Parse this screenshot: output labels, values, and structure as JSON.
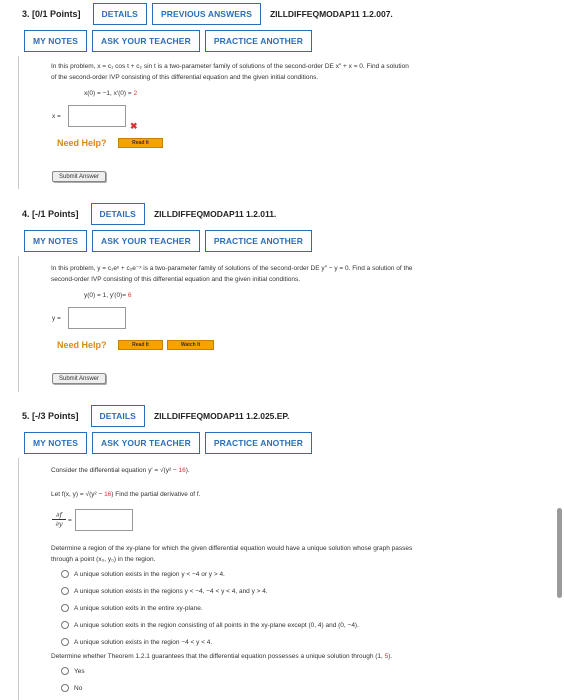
{
  "q3": {
    "number": "3. [0/1 Points]",
    "code": "ZILLDIFFEQMODAP11 1.2.007.",
    "details": "DETAILS",
    "previous": "PREVIOUS ANSWERS",
    "my_notes": "MY NOTES",
    "ask": "ASK YOUR TEACHER",
    "practice": "PRACTICE ANOTHER",
    "prompt_a": "In this problem, x = c₁ cos t + c₂ sin t is a two-parameter family of solutions of the second-order DE x″ + x = 0. Find a solution",
    "prompt_b": "of the second-order IVP consisting of this differential equation and the given initial conditions.",
    "cond_a": "x(0) = −1,  x′(0) = ",
    "cond_b": "2",
    "answer_label": "x =",
    "wrong_mark": "✖",
    "need_help": "Need Help?",
    "read_it": "Read It",
    "submit": "Submit Answer"
  },
  "q4": {
    "number": "4. [-/1 Points]",
    "code": "ZILLDIFFEQMODAP11 1.2.011.",
    "details": "DETAILS",
    "my_notes": "MY NOTES",
    "ask": "ASK YOUR TEACHER",
    "practice": "PRACTICE ANOTHER",
    "prompt_a": "In this problem, y = c₁eˣ + c₂e⁻ˣ is a two-parameter family of solutions of the second-order DE y″ − y = 0. Find a solution of the",
    "prompt_b": "second-order IVP consisting of this differential equation and the given initial conditions.",
    "cond_a": "y(0) = 1,  y′(0)= ",
    "cond_b": "6",
    "answer_label": "y =",
    "need_help": "Need Help?",
    "read_it": "Read It",
    "watch_it": "Watch It",
    "submit": "Submit Answer"
  },
  "q5": {
    "number": "5. [-/3 Points]",
    "code": "ZILLDIFFEQMODAP11 1.2.025.EP.",
    "details": "DETAILS",
    "my_notes": "MY NOTES",
    "ask": "ASK YOUR TEACHER",
    "practice": "PRACTICE ANOTHER",
    "consider_a": "Consider the differential equation y′ = √(y² − ",
    "consider_b": "16",
    "consider_c": ").",
    "let_a": "Let f(x, y) = √(y² − ",
    "let_b": "16",
    "let_c": ")  Find the partial derivative of f.",
    "partial_num": "∂f",
    "partial_den": "∂y",
    "eq": "=",
    "region_a": "Determine a region of the xy-plane for which the given differential equation would have a unique solution whose graph passes",
    "region_b": "through a point (x₀, y₀) in the region.",
    "options": [
      "A unique solution exists in the region y < −4 or y > 4.",
      "A unique solution exists in the regions y < −4, −4 < y < 4, and y > 4.",
      "A unique solution exits in the entire xy-plane.",
      "A unique solution exits in the region consisting of all points in the xy-plane except (0, 4) and (0, −4).",
      "A unique solution exists in the region −4 < y < 4."
    ],
    "theorem_a": "Determine whether Theorem 1.2.1 guarantees that the differential equation possesses a unique solution through (1, ",
    "theorem_b": "5",
    "theorem_c": ").",
    "yes": "Yes",
    "no": "No"
  }
}
